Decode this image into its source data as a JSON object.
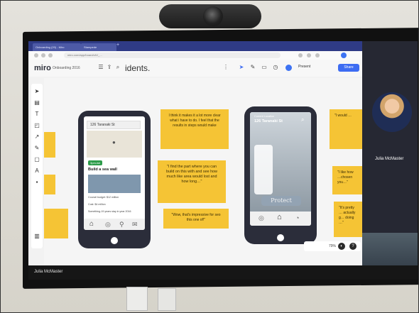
{
  "browser": {
    "tabs": [
      "Onboarding (20) - Miro",
      "Stampede",
      "+"
    ],
    "address": "miro.com/app/board/o9J_..."
  },
  "miro": {
    "logo": "miro",
    "board_name": "Onboarding 2016",
    "board_title": "idents.",
    "present_label": "Present",
    "share_label": "Share",
    "zoom": "79%"
  },
  "stickies": {
    "s1": "I think it makes it a lot more clear what i have to do. I feel that the results in steps would make",
    "s2": "\"I find the part where you can build on this with and see how much like area would lost and how long…\"",
    "s3": "\"Wow, that's impressive for seo this one of!\"",
    "s4": "\"I would …",
    "s5": "\"I like how …chosen you…\"",
    "s6": "\"It's pretty … actually g… doing …\""
  },
  "phone1": {
    "address": "126 Taranaki St",
    "tag": "3pm-ish",
    "heading": "Build a sea wall",
    "line1": "Council budget: $12 million",
    "line2": "Cost: $4 million",
    "line3": "Something-19 years stay in year 2016"
  },
  "phone2": {
    "label_small": "Current Location",
    "address": "126 Taranaki St",
    "protect_label": "Protect"
  },
  "video": {
    "participant_name": "Julia McMaster"
  },
  "meeting": {
    "bottom_name": "Julia McMaster"
  }
}
